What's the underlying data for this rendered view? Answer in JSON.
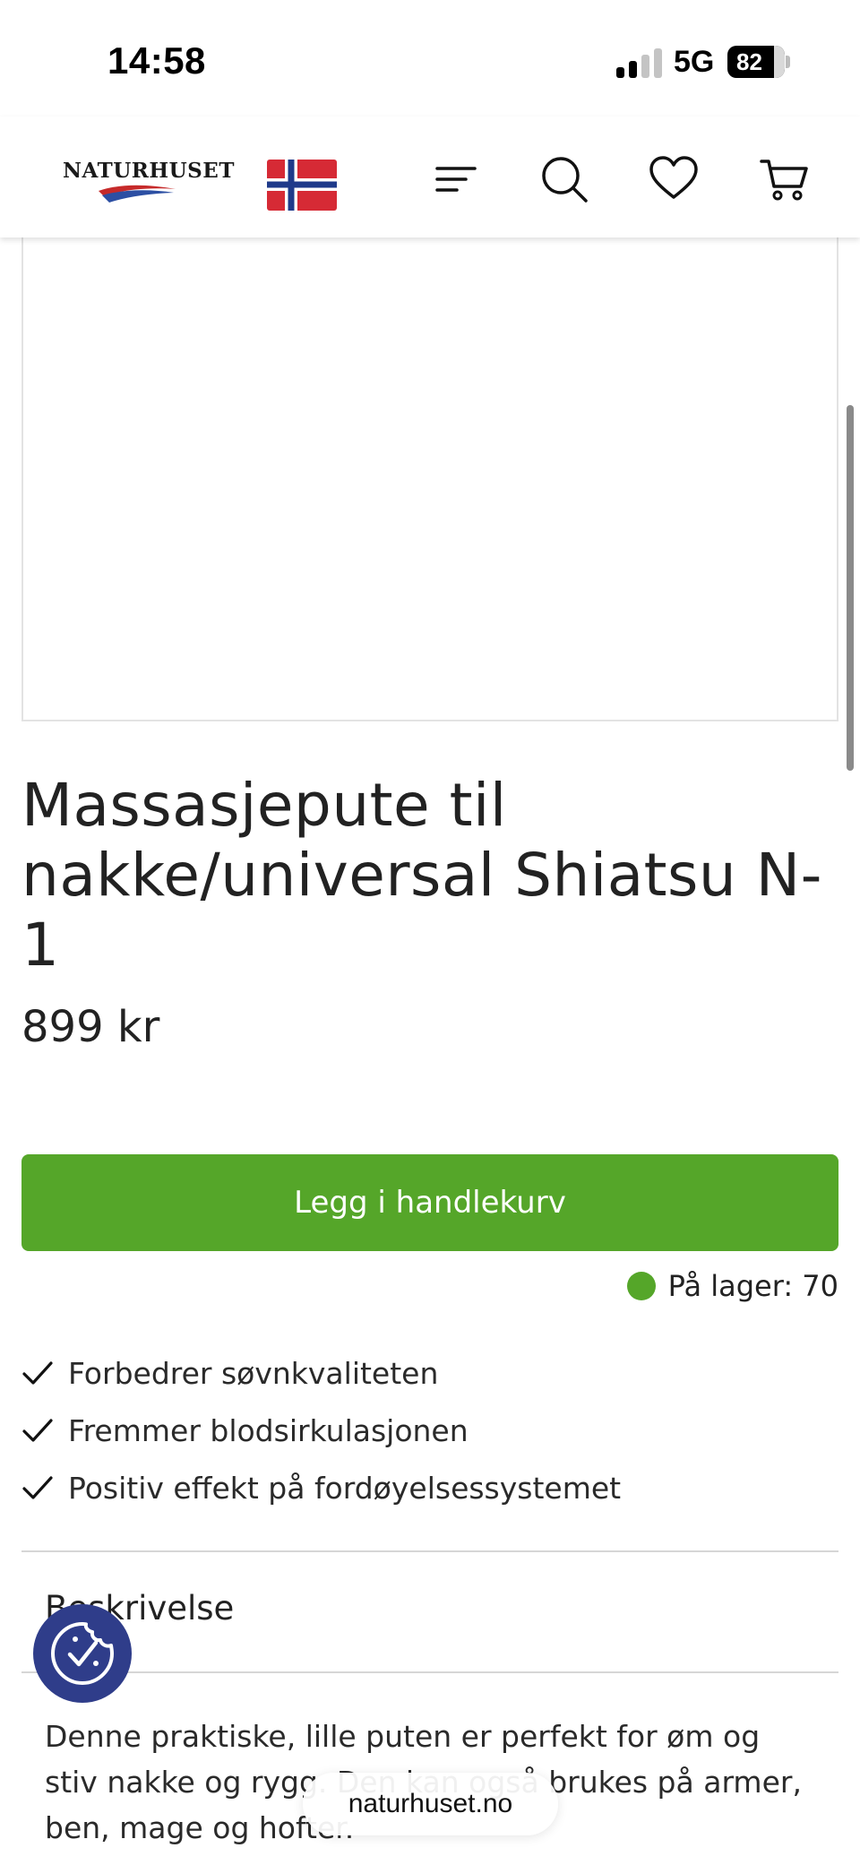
{
  "status_bar": {
    "time": "14:58",
    "network": "5G",
    "battery": "82"
  },
  "header": {
    "logo_text": "NATURHUSET",
    "flag": "norway-flag-icon",
    "icons": [
      "menu-icon",
      "search-icon",
      "heart-icon",
      "cart-icon"
    ]
  },
  "product": {
    "title": "Massasjepute til nakke/universal Shiatsu N-1",
    "price": "899 kr",
    "add_to_cart_label": "Legg i handlekurv",
    "stock_label": "På lager: 70",
    "features": [
      "Forbedrer søvnkvaliteten",
      "Fremmer blodsirkulasjonen",
      "Positiv effekt på fordøyelsessystemet"
    ],
    "description_heading": "Beskrivelse",
    "description_text": "Denne praktiske, lille puten er perfekt for øm og stiv nakke og rygg. Den kan også brukes på armer, ben, mage og hofter."
  },
  "browser": {
    "url": "naturhuset.no"
  },
  "colors": {
    "accent_green": "#55a629",
    "cookie_button": "#2f3d8a"
  }
}
